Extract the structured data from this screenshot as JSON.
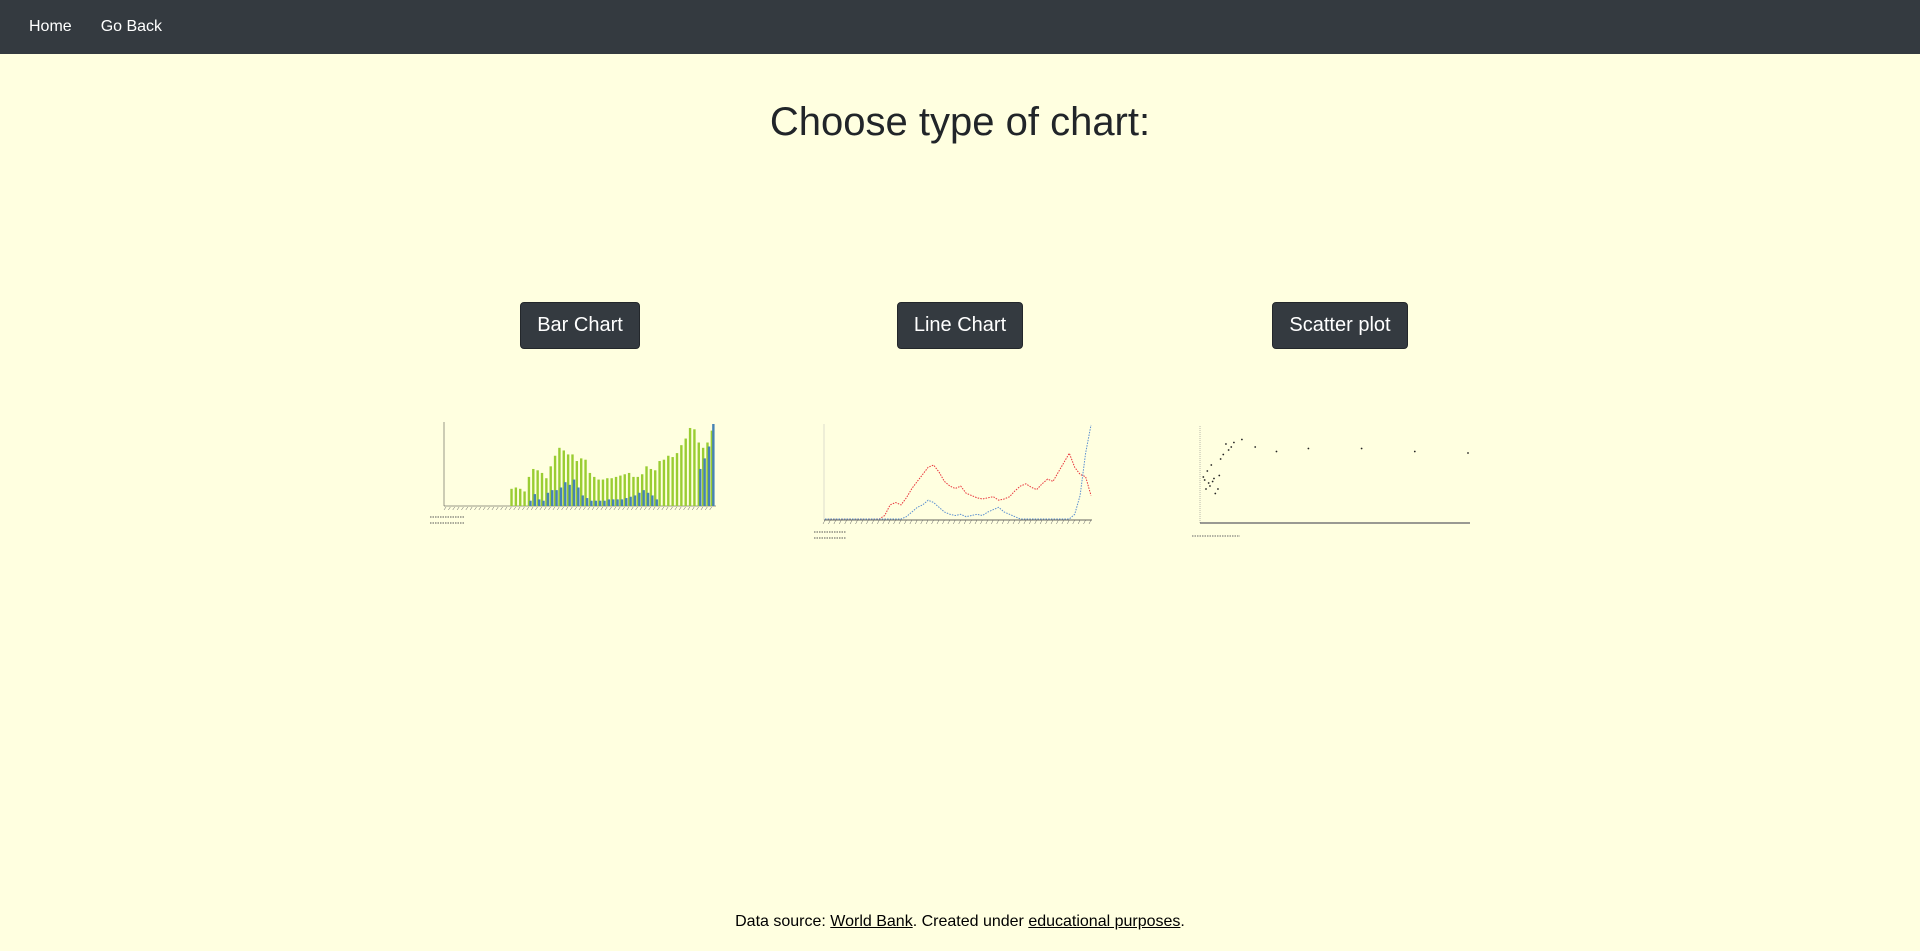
{
  "nav": {
    "home": "Home",
    "back": "Go Back"
  },
  "title": "Choose type of chart:",
  "buttons": {
    "bar": "Bar Chart",
    "line": "Line Chart",
    "scatter": "Scatter plot"
  },
  "footer": {
    "prefix": "Data source: ",
    "source_link": "World Bank",
    "middle": ". Created under ",
    "purpose_link": "educational purposes",
    "suffix": "."
  },
  "colors": {
    "navbar": "#343a40",
    "background": "#ffffe0",
    "bar_green": "#9acd32",
    "bar_blue": "#4682b4",
    "line_red": "#e8333a",
    "line_blue": "#5b8fd0"
  },
  "chart_data": [
    {
      "type": "bar",
      "series": [
        {
          "values": [
            0,
            0,
            0,
            0,
            0,
            0,
            0,
            0,
            0,
            0,
            0,
            0,
            0,
            0,
            0,
            13,
            14,
            13,
            11,
            22,
            28,
            27,
            25,
            21,
            30,
            38,
            44,
            42,
            39,
            39,
            34,
            36,
            35,
            25,
            22,
            20,
            20,
            21,
            21,
            22,
            23,
            24,
            25,
            22,
            22,
            24,
            30,
            28,
            27,
            34,
            35,
            38,
            37,
            40,
            46,
            51,
            59,
            58,
            48,
            44,
            48,
            57
          ]
        },
        {
          "values": [
            0,
            0,
            0,
            0,
            0,
            0,
            0,
            0,
            0,
            0,
            0,
            0,
            0,
            0,
            0,
            0,
            0,
            0,
            0,
            4,
            9,
            5,
            4,
            10,
            12,
            12,
            14,
            18,
            16,
            20,
            14,
            8,
            6,
            4,
            4,
            4,
            4,
            5,
            5,
            5,
            5,
            6,
            7,
            8,
            10,
            12,
            10,
            8,
            5,
            0,
            0,
            0,
            0,
            0,
            0,
            0,
            0,
            0,
            28,
            36,
            45,
            62
          ]
        }
      ]
    },
    {
      "type": "line",
      "series": [
        {
          "values": [
            0,
            0,
            0,
            0,
            0,
            0,
            0,
            0,
            0,
            0,
            0,
            3,
            12,
            14,
            12,
            18,
            26,
            32,
            38,
            44,
            46,
            40,
            32,
            28,
            26,
            28,
            22,
            20,
            18,
            17,
            18,
            19,
            16,
            17,
            19,
            24,
            28,
            30,
            27,
            25,
            30,
            34,
            32,
            40,
            48,
            56,
            44,
            38,
            36,
            20
          ]
        },
        {
          "values": [
            0,
            0,
            0,
            0,
            0,
            0,
            0,
            0,
            0,
            0,
            0,
            0,
            0,
            0,
            0,
            2,
            6,
            10,
            12,
            16,
            14,
            10,
            6,
            4,
            3,
            4,
            2,
            3,
            4,
            3,
            6,
            8,
            10,
            6,
            4,
            2,
            0,
            0,
            0,
            0,
            0,
            0,
            0,
            0,
            0,
            0,
            4,
            20,
            56,
            80
          ]
        }
      ]
    },
    {
      "type": "scatter",
      "points": [
        [
          0.5,
          30
        ],
        [
          1,
          28
        ],
        [
          1.5,
          22
        ],
        [
          2,
          34
        ],
        [
          2.5,
          26
        ],
        [
          3,
          24
        ],
        [
          3.5,
          38
        ],
        [
          4,
          27
        ],
        [
          4.5,
          29
        ],
        [
          5,
          19
        ],
        [
          6,
          22
        ],
        [
          6.5,
          31
        ],
        [
          7,
          42
        ],
        [
          8,
          45
        ],
        [
          9,
          52
        ],
        [
          10,
          48
        ],
        [
          11,
          50
        ],
        [
          12,
          53
        ],
        [
          15,
          55
        ],
        [
          20,
          50
        ],
        [
          28,
          47
        ],
        [
          40,
          49
        ],
        [
          60,
          49
        ],
        [
          80,
          47
        ],
        [
          100,
          46
        ]
      ]
    }
  ]
}
